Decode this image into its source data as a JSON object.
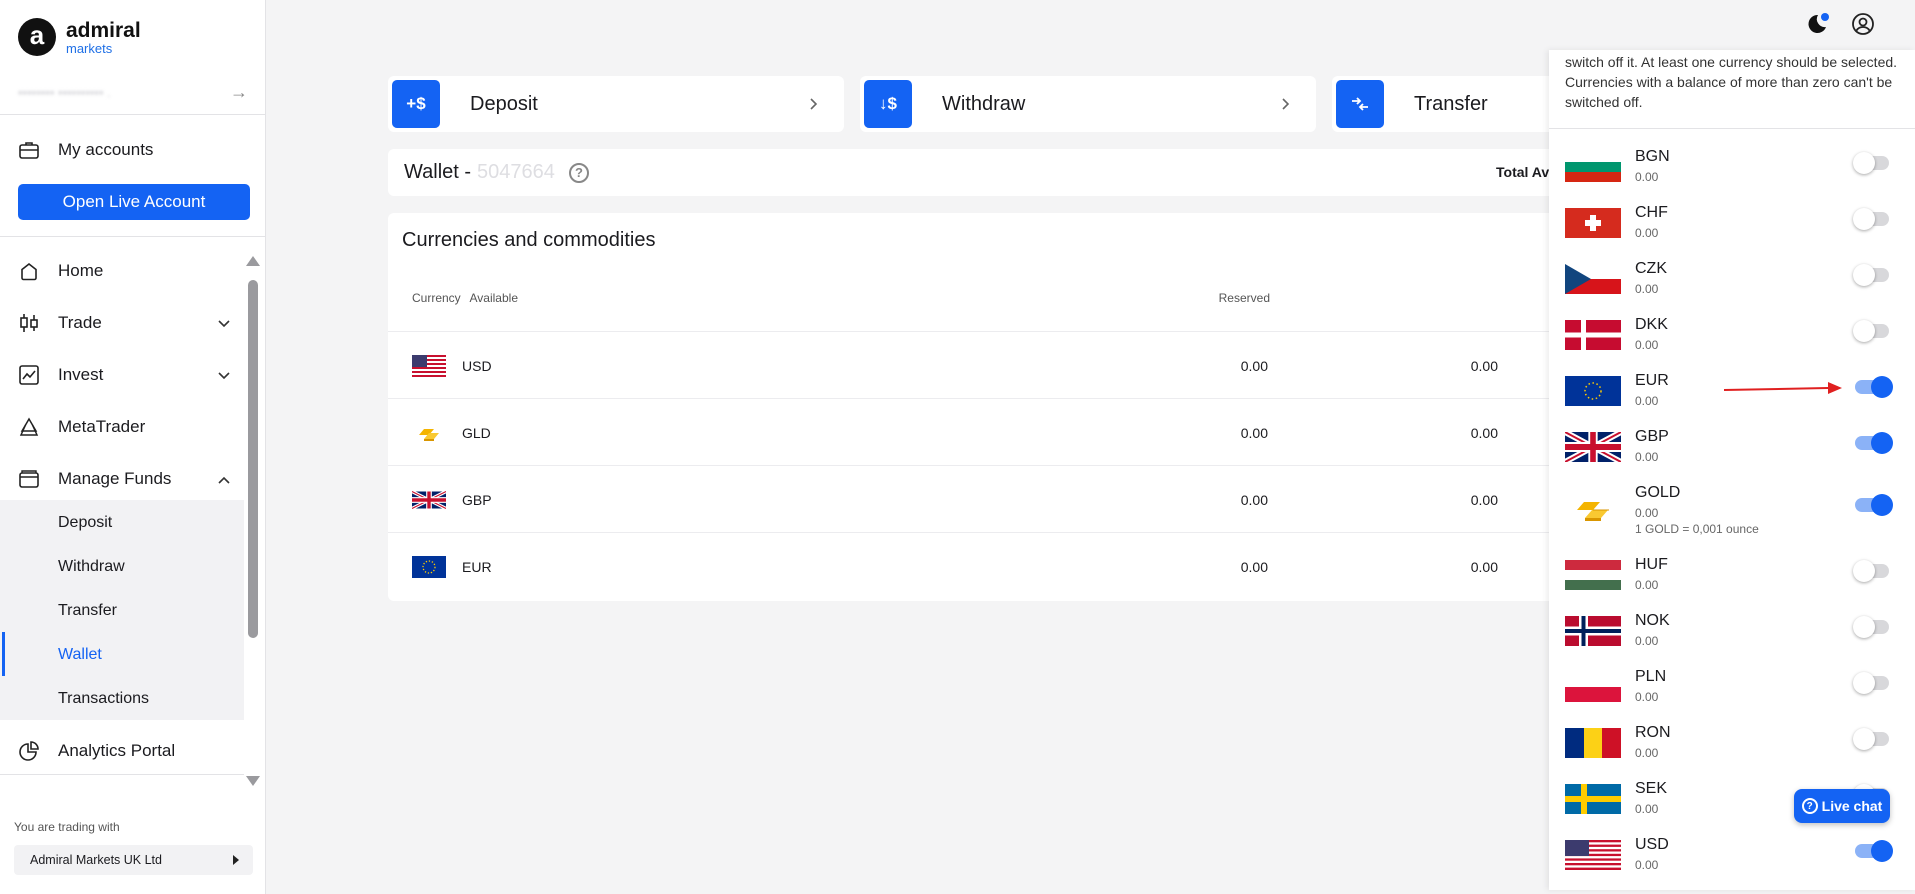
{
  "brand": {
    "title": "admiral",
    "sub": "markets",
    "mark": "a"
  },
  "sidebar": {
    "account_masked": "•••••••• •••••••••• .",
    "my_accounts": "My accounts",
    "open_live": "Open Live Account",
    "home": "Home",
    "trade": "Trade",
    "invest": "Invest",
    "metatrader": "MetaTrader",
    "manage_funds": "Manage Funds",
    "sub": {
      "deposit": "Deposit",
      "withdraw": "Withdraw",
      "transfer": "Transfer",
      "wallet": "Wallet",
      "transactions": "Transactions"
    },
    "analytics": "Analytics Portal",
    "trading_with_label": "You are trading with",
    "entity": "Admiral Markets UK Ltd"
  },
  "actions": {
    "deposit": "Deposit",
    "withdraw": "Withdraw",
    "transfer": "Transfer",
    "deposit_icon": "+$",
    "withdraw_icon": "↓$"
  },
  "wallet": {
    "title": "Wallet -",
    "id_masked": "5047664",
    "total_label": "Total Ava"
  },
  "currencies": {
    "title": "Currencies and commodities",
    "headers": {
      "currency": "Currency",
      "available": "Available",
      "reserved": "Reserved"
    },
    "rows": [
      {
        "code": "USD",
        "available": "0.00",
        "reserved": "0.00"
      },
      {
        "code": "GLD",
        "available": "0.00",
        "reserved": "0.00"
      },
      {
        "code": "GBP",
        "available": "0.00",
        "reserved": "0.00"
      },
      {
        "code": "EUR",
        "available": "0.00",
        "reserved": "0.00"
      }
    ]
  },
  "panel": {
    "description": "switch off it. At least one currency should be selected. Currencies with a balance of more than zero can't be switched off.",
    "items": [
      {
        "code": "BGN",
        "balance": "0.00",
        "enabled": false
      },
      {
        "code": "CHF",
        "balance": "0.00",
        "enabled": false
      },
      {
        "code": "CZK",
        "balance": "0.00",
        "enabled": false
      },
      {
        "code": "DKK",
        "balance": "0.00",
        "enabled": false
      },
      {
        "code": "EUR",
        "balance": "0.00",
        "enabled": true
      },
      {
        "code": "GBP",
        "balance": "0.00",
        "enabled": true
      },
      {
        "code": "GOLD",
        "balance": "0.00",
        "note": "1 GOLD = 0,001 ounce",
        "enabled": true
      },
      {
        "code": "HUF",
        "balance": "0.00",
        "enabled": false
      },
      {
        "code": "NOK",
        "balance": "0.00",
        "enabled": false
      },
      {
        "code": "PLN",
        "balance": "0.00",
        "enabled": false
      },
      {
        "code": "RON",
        "balance": "0.00",
        "enabled": false
      },
      {
        "code": "SEK",
        "balance": "0.00",
        "enabled": false
      },
      {
        "code": "USD",
        "balance": "0.00",
        "enabled": true
      }
    ]
  },
  "live_chat": "Live chat",
  "colors": {
    "accent": "#1463f3",
    "annotation_arrow": "#e02020"
  }
}
